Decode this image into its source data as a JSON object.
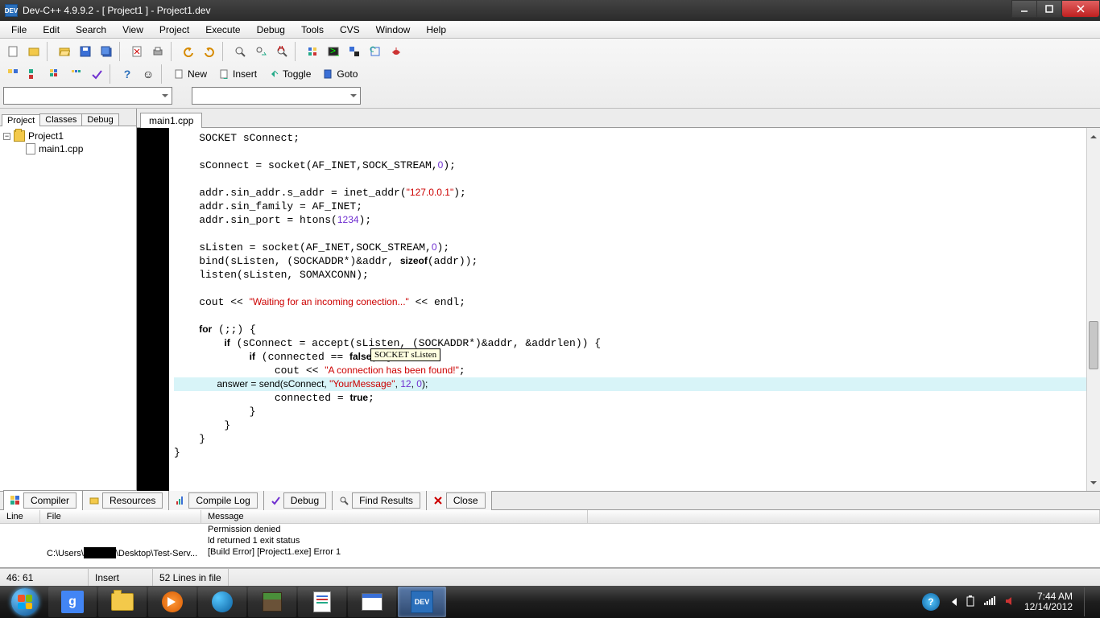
{
  "window": {
    "title": "Dev-C++ 4.9.9.2  -  [ Project1 ] - Project1.dev"
  },
  "menu": [
    "File",
    "Edit",
    "Search",
    "View",
    "Project",
    "Execute",
    "Debug",
    "Tools",
    "CVS",
    "Window",
    "Help"
  ],
  "toolbar2": {
    "new": "New",
    "insert": "Insert",
    "toggle": "Toggle",
    "goto": "Goto"
  },
  "sidebar": {
    "tabs": [
      "Project",
      "Classes",
      "Debug"
    ],
    "project": "Project1",
    "file": "main1.cpp"
  },
  "editor": {
    "tab": "main1.cpp",
    "tooltip": "SOCKET sListen",
    "code": [
      {
        "t": "    SOCKET sConnect;"
      },
      {
        "t": ""
      },
      {
        "t": "    sConnect = socket(AF_INET,SOCK_STREAM,§0§);"
      },
      {
        "t": ""
      },
      {
        "t": "    addr.sin_addr.s_addr = inet_addr(¤\"127.0.0.1\"¤);"
      },
      {
        "t": "    addr.sin_family = AF_INET;"
      },
      {
        "t": "    addr.sin_port = htons(§1234§);"
      },
      {
        "t": ""
      },
      {
        "t": "    sListen = socket(AF_INET,SOCK_STREAM,§0§);"
      },
      {
        "t": "    bind(sListen, (SOCKADDR*)&addr, ★sizeof★(addr));"
      },
      {
        "t": "    listen(sListen, SOMAXCONN);"
      },
      {
        "t": ""
      },
      {
        "t": "    cout << ¤\"Waiting for an incoming conection...\"¤ << endl;"
      },
      {
        "t": ""
      },
      {
        "t": "    ★for★ (;;) {"
      },
      {
        "t": "        ★if★ (sConnect = accept(sListen, (SOCKADDR*)&addr, &addrlen)) {"
      },
      {
        "t": "            ★if★ (connected == ★false★) {"
      },
      {
        "t": "                cout << ¤\"A connection has been found!\"¤;"
      },
      {
        "t": "                answer = send(sConnect, ¤\"YourMessage\"¤, §12§, §0§);",
        "hl": true
      },
      {
        "t": "                connected = ★true★;"
      },
      {
        "t": "            }"
      },
      {
        "t": "        }"
      },
      {
        "t": "    }"
      },
      {
        "t": "}"
      }
    ]
  },
  "bottom_tabs": [
    "Compiler",
    "Resources",
    "Compile Log",
    "Debug",
    "Find Results",
    "Close"
  ],
  "compiler": {
    "headers": [
      "Line",
      "File",
      "Message"
    ],
    "rows": [
      {
        "line": "",
        "file": "",
        "msg": "Permission denied"
      },
      {
        "line": "",
        "file": "",
        "msg": "ld returned 1 exit status"
      },
      {
        "line": "",
        "file": "C:\\Users\\█████\\Desktop\\Test-Serv...",
        "msg": "[Build Error]  [Project1.exe] Error 1"
      }
    ]
  },
  "status": {
    "pos": "46: 61",
    "mode": "Insert",
    "lines": "52 Lines in file"
  },
  "tray": {
    "time": "7:44 AM",
    "date": "12/14/2012"
  }
}
